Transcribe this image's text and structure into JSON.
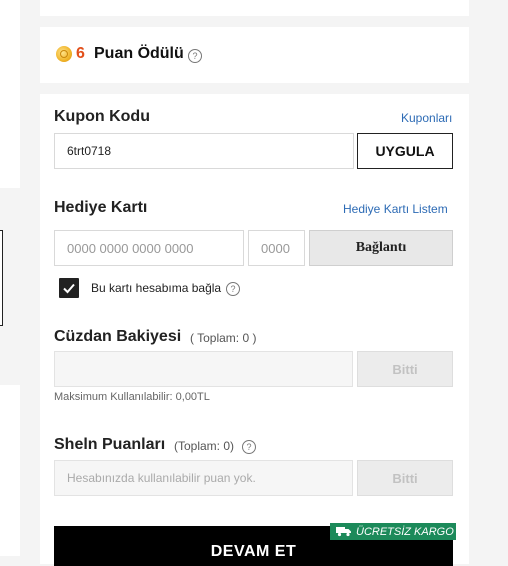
{
  "points": {
    "count": "6",
    "title": "Puan Ödülü",
    "help_icon": "question-circle-icon"
  },
  "coupon": {
    "title": "Kupon Kodu",
    "link": "Kuponları",
    "value": "6trt0718",
    "apply_label": "UYGULA"
  },
  "gift_card": {
    "title": "Hediye Kartı",
    "link": "Hediye Kartı Listem",
    "number_placeholder": "0000 0000 0000 0000",
    "pin_placeholder": "0000",
    "connect_label": "Bağlantı",
    "bind_label": "Bu kartı hesabıma bağla",
    "bind_checked": true
  },
  "wallet": {
    "title": "Cüzdan Bakiyesi",
    "total": "( Toplam: 0 )",
    "button_label": "Bitti",
    "max_note": "Maksimum Kullanılabilir: 0,00TL"
  },
  "shein_points": {
    "title": "Sheln Puanları",
    "total": "(Toplam: 0)",
    "placeholder": "Hesabınızda kullanılabilir puan yok.",
    "button_label": "Bitti"
  },
  "shipping_badge": {
    "label": "ÜCRETSİZ KARGO",
    "icon": "truck-icon"
  },
  "checkout": {
    "label": "DEVAM ET"
  },
  "colors": {
    "accent": "#e2501b",
    "link": "#2d6bb5",
    "badge": "#1c8a5a"
  }
}
